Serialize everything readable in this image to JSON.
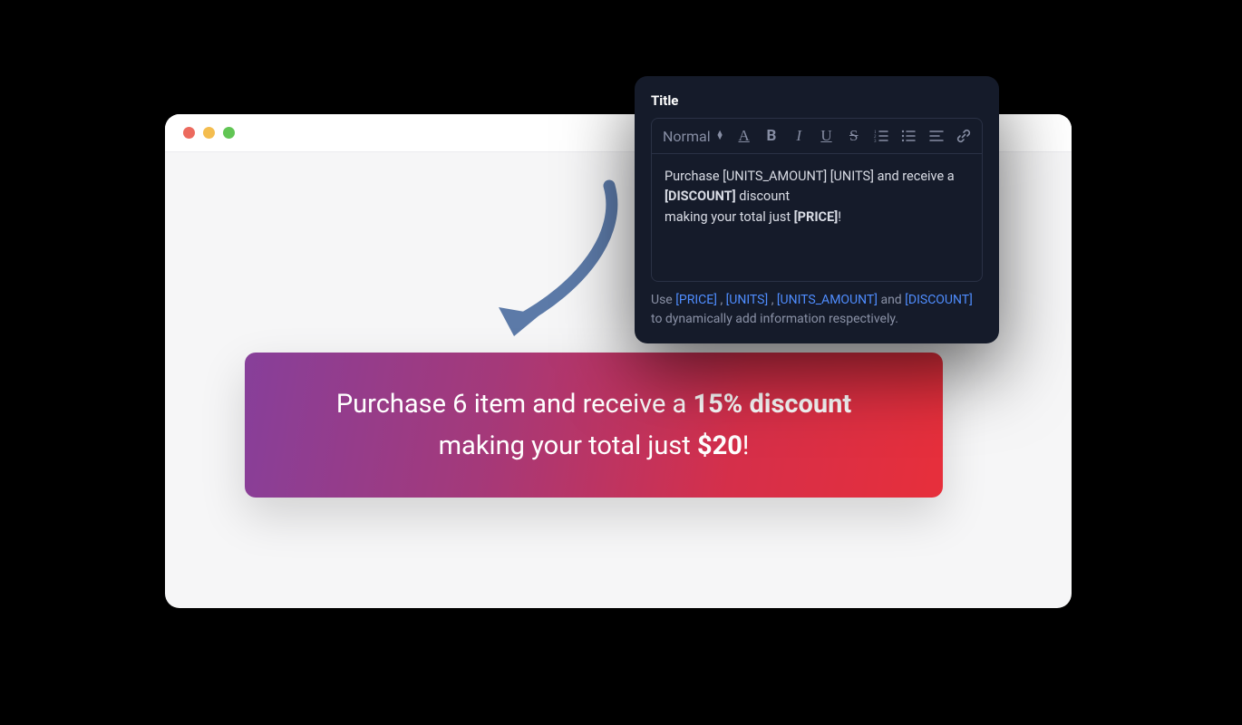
{
  "browser": {
    "traffic_lights": [
      "close",
      "minimize",
      "zoom"
    ]
  },
  "promo": {
    "line1_prefix": "Purchase ",
    "units_amount": "6",
    "space1": " ",
    "units": "item",
    "line1_mid": " and receive a ",
    "discount": "15% discount",
    "line2_prefix": "making your total just ",
    "price": "$20",
    "line2_suffix": "!"
  },
  "panel": {
    "title": "Title",
    "toolbar": {
      "heading_select": "Normal",
      "icons": [
        "font-color",
        "bold",
        "italic",
        "underline",
        "strike",
        "ol",
        "ul",
        "align",
        "link"
      ]
    },
    "editor": {
      "l1a": "Purchase ",
      "l1b": "[UNITS_AMOUNT]",
      "l1c": " ",
      "l1d": "[UNITS]",
      "l1e": " and receive a",
      "l2a": "[DISCOUNT]",
      "l2b": " discount",
      "l3a": "making your total just ",
      "l3b": "[PRICE]",
      "l3c": "!"
    },
    "hint": {
      "pre": "Use ",
      "t1": "[PRICE]",
      "c1": " , ",
      "t2": "[UNITS]",
      "c2": " , ",
      "t3": "[UNITS_AMOUNT]",
      "c3": " and ",
      "t4": "[DISCOUNT]",
      "suf": " to dynamically add information respectively."
    }
  }
}
